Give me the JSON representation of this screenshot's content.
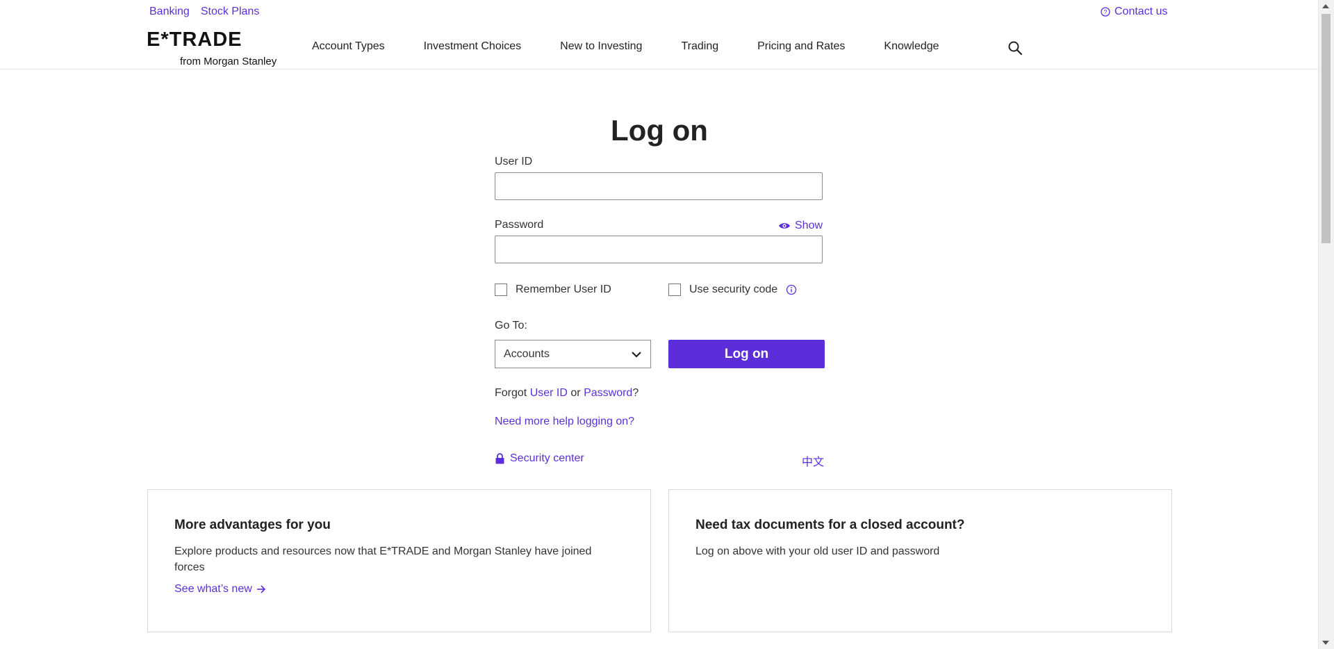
{
  "utility": {
    "links": [
      "Banking",
      "Stock Plans"
    ],
    "contact_label": "Contact us"
  },
  "header": {
    "logo_text": "E*TRADE",
    "logo_sub": "from Morgan Stanley",
    "nav": [
      "Account Types",
      "Investment Choices",
      "New to Investing",
      "Trading",
      "Pricing and Rates",
      "Knowledge"
    ]
  },
  "login": {
    "title": "Log on",
    "user_id_label": "User ID",
    "user_id_value": "",
    "password_label": "Password",
    "password_value": "",
    "show_label": "Show",
    "remember_label": "Remember User ID",
    "security_code_label": "Use security code",
    "goto_label": "Go To:",
    "goto_selected": "Accounts",
    "submit_label": "Log on",
    "forgot_prefix": "Forgot",
    "forgot_user_id": "User ID",
    "forgot_or": "or",
    "forgot_password": "Password",
    "forgot_suffix": "?",
    "help_link": "Need more help logging on?",
    "security_center": "Security center",
    "language_link": "中文"
  },
  "cards": [
    {
      "title": "More advantages for you",
      "body": "Explore products and resources now that E*TRADE and Morgan Stanley have joined forces",
      "link": "See what’s new"
    },
    {
      "title": "Need tax documents for a closed account?",
      "body": "Log on above with your old user ID and password"
    }
  ],
  "colors": {
    "accent": "#5b2ed9",
    "text": "#222222",
    "border": "#d9d9d9"
  }
}
